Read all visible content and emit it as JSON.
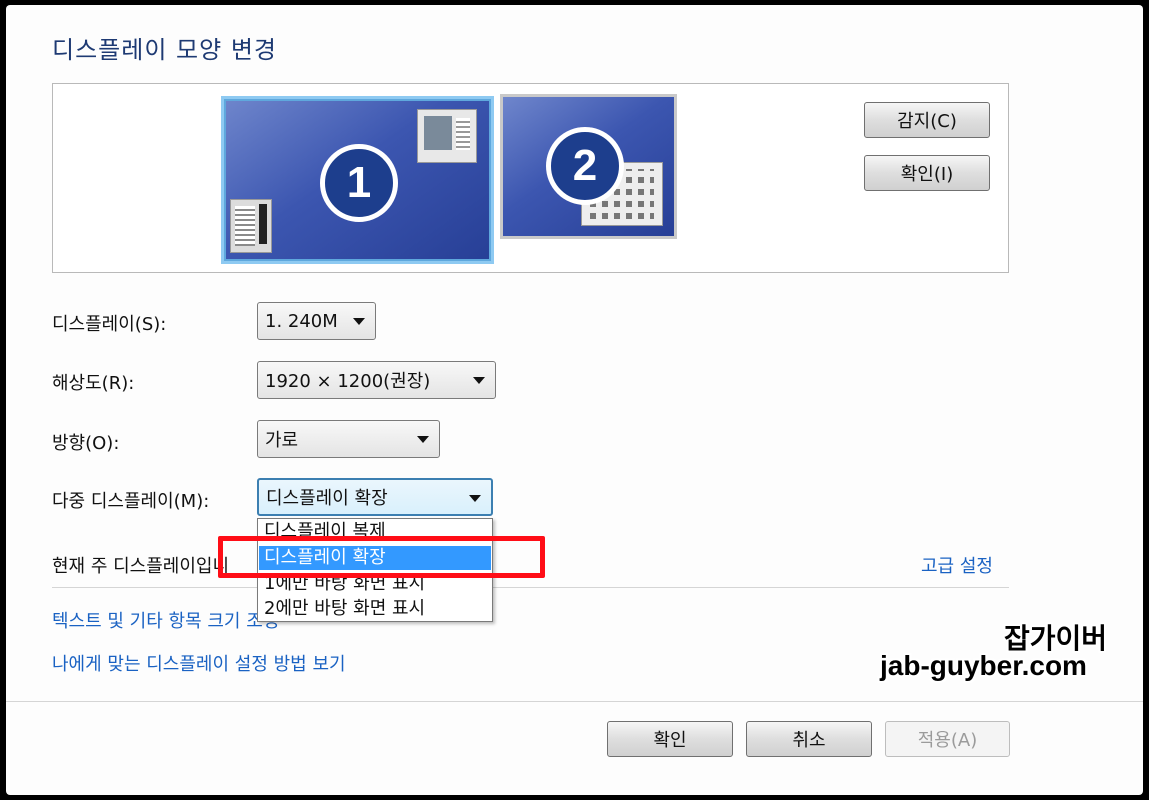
{
  "dialog": {
    "title": "디스플레이 모양 변경"
  },
  "preview": {
    "monitor1_number": "1",
    "monitor2_number": "2",
    "detect_button": "감지(C)",
    "identify_button": "확인(I)"
  },
  "settings": {
    "display_label": "디스플레이(S):",
    "display_value": "1. 240M",
    "resolution_label": "해상도(R):",
    "resolution_value": "1920 × 1200(권장)",
    "orientation_label": "방향(O):",
    "orientation_value": "가로",
    "multi_label": "다중 디스플레이(M):",
    "multi_value": "디스플레이 확장",
    "multi_options": [
      "디스플레이 복제",
      "디스플레이 확장",
      "1에만 바탕 화면 표시",
      "2에만 바탕 화면 표시"
    ],
    "multi_selected_index": 1
  },
  "info": {
    "primary_text": "현재 주 디스플레이입니",
    "advanced_link": "고급 설정",
    "text_size_link": "텍스트 및 기타 항목 크기 조정",
    "help_link": "나에게 맞는 디스플레이 설정 방법 보기"
  },
  "footer": {
    "ok": "확인",
    "cancel": "취소",
    "apply": "적용(A)"
  },
  "watermark": {
    "line1": "잡가이버",
    "line2": "jab-guyber.com"
  },
  "colors": {
    "title": "#1e3a73",
    "link": "#1a62c3",
    "selection": "#3399ff",
    "annotation": "#ff0d16"
  }
}
